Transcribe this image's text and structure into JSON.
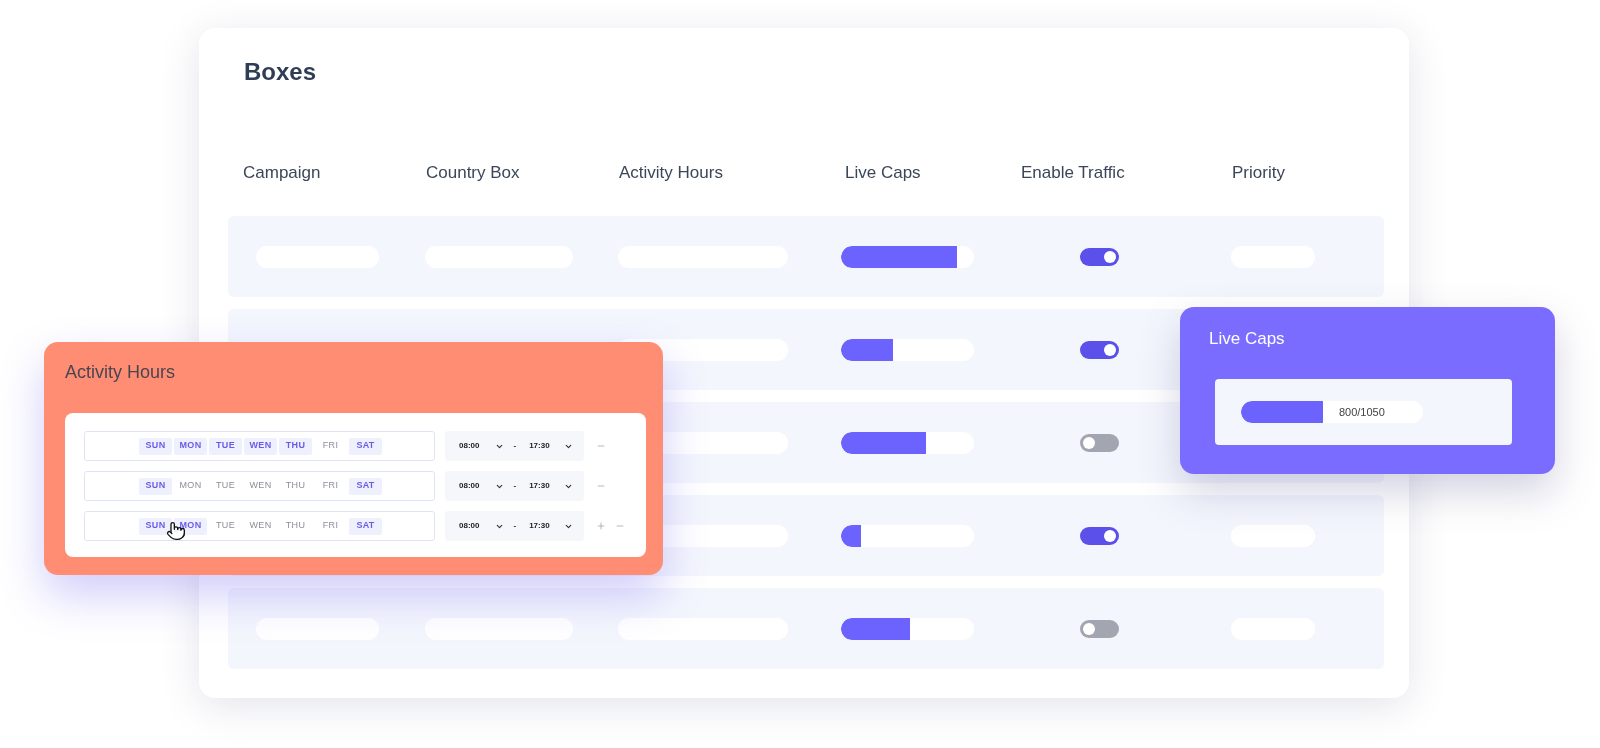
{
  "boxes_panel": {
    "title": "Boxes",
    "columns": [
      "Campaign",
      "Country Box",
      "Activity Hours",
      "Live Caps",
      "Enable Traffic",
      "Priority"
    ],
    "rows": [
      {
        "level": 0.87,
        "on": true
      },
      {
        "level": 0.39,
        "on": true
      },
      {
        "level": 0.64,
        "on": false
      },
      {
        "level": 0.15,
        "on": true
      },
      {
        "level": 0.52,
        "on": false
      }
    ]
  },
  "activity_hours_card": {
    "title": "Activity Hours",
    "schedules": [
      {
        "days": [
          {
            "label": "SUN",
            "selected": true
          },
          {
            "label": "MON",
            "selected": true
          },
          {
            "label": "TUE",
            "selected": true
          },
          {
            "label": "WEN",
            "selected": true
          },
          {
            "label": "THU",
            "selected": true
          },
          {
            "label": "FRI",
            "selected": false
          },
          {
            "label": "SAT",
            "selected": true
          }
        ],
        "start": "08:00",
        "separator": "-",
        "end": "17:30",
        "actions": [
          {
            "kind": "remove"
          }
        ]
      },
      {
        "days": [
          {
            "label": "SUN",
            "selected": true
          },
          {
            "label": "MON",
            "selected": false
          },
          {
            "label": "TUE",
            "selected": false
          },
          {
            "label": "WEN",
            "selected": false
          },
          {
            "label": "THU",
            "selected": false
          },
          {
            "label": "FRI",
            "selected": false
          },
          {
            "label": "SAT",
            "selected": true
          }
        ],
        "start": "08:00",
        "separator": "-",
        "end": "17:30",
        "actions": [
          {
            "kind": "remove"
          }
        ]
      },
      {
        "days": [
          {
            "label": "SUN",
            "selected": true
          },
          {
            "label": "MON",
            "selected": true
          },
          {
            "label": "TUE",
            "selected": false
          },
          {
            "label": "WEN",
            "selected": false
          },
          {
            "label": "THU",
            "selected": false
          },
          {
            "label": "FRI",
            "selected": false
          },
          {
            "label": "SAT",
            "selected": true
          }
        ],
        "start": "08:00",
        "separator": "-",
        "end": "17:30",
        "actions": [
          {
            "kind": "add"
          },
          {
            "kind": "remove"
          }
        ]
      }
    ]
  },
  "live_caps_card": {
    "title": "Live Caps",
    "level": 0.45,
    "reading": "800/1050"
  }
}
